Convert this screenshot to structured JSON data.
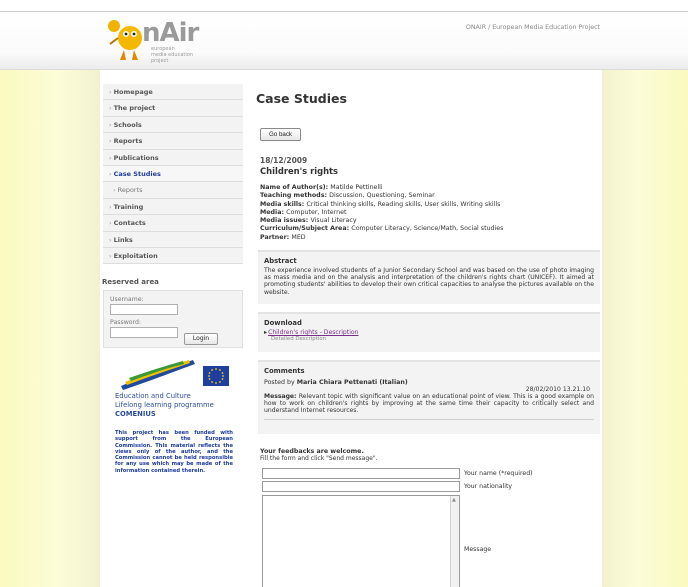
{
  "header": {
    "logo_word": "nAir",
    "logo_sub": [
      "european",
      "media education",
      "project"
    ],
    "site_title": "ONAIR / European Media Education Project"
  },
  "nav": {
    "items": [
      {
        "label": "Homepage"
      },
      {
        "label": "The project"
      },
      {
        "label": "Schools"
      },
      {
        "label": "Reports"
      },
      {
        "label": "Publications"
      },
      {
        "label": "Case Studies",
        "active": true
      },
      {
        "label": "Reports",
        "sub": true
      },
      {
        "label": "Training"
      },
      {
        "label": "Contacts"
      },
      {
        "label": "Links"
      },
      {
        "label": "Exploitation"
      }
    ]
  },
  "reserved": {
    "title": "Reserved area",
    "username_label": "Username:",
    "password_label": "Password:",
    "login_label": "Login"
  },
  "sidebar_footer": {
    "edu_line1": "Education and Culture",
    "edu_line2": "Lifelong learning programme",
    "edu_line3": "COMENIUS",
    "funding": "This project has been funded with support from the European Commission. This material reflects the views only of the author, and the Commission cannot be held responsible for any use which may be made of the information contained therein."
  },
  "main": {
    "page_title": "Case Studies",
    "go_back": "Go back",
    "date": "18/12/2009",
    "case_title": "Children's rights",
    "meta": [
      {
        "k": "Name of Author(s): ",
        "v": "Matilde Pettinelli"
      },
      {
        "k": "Teaching methods: ",
        "v": "Discussion, Questioning, Seminar"
      },
      {
        "k": "Media skills: ",
        "v": "Critical thinking skills, Reading skills, User skills, Writing skills"
      },
      {
        "k": "Media: ",
        "v": "Computer, Internet"
      },
      {
        "k": "Media issues: ",
        "v": "Visual Literacy"
      },
      {
        "k": "Curriculum/Subject Area: ",
        "v": "Computer Literacy, Science/Math, Social studies"
      },
      {
        "k": "Partner: ",
        "v": "MED"
      }
    ],
    "abstract": {
      "title": "Abstract",
      "body": "The experience involved students of a Junior Secondary School and was based on the use of photo imaging as mass media and on the analysis and interpretation of the children's rights chart (UNICEF). It aimed at promoting students' abilities to develop their own critical capacities to analyse the pictures available on the website."
    },
    "download": {
      "title": "Download",
      "link": "Children's rights - Description",
      "desc": "Detailed Description"
    },
    "comments": {
      "title": "Comments",
      "posted_by": "Posted by ",
      "author": "Maria Chiara Pettenati (Italian)",
      "date": "28/02/2010 13.21.10",
      "message_label": "Message: ",
      "message": "Relevant topic with significant value on an educational point of view. This is a good example on how to work on children's rights by improving at the same time their capacity to critically select and understand Internet resources."
    },
    "feedback": {
      "title": "Your feedbacks are welcome.",
      "subtitle": "Fill the form and click \"Send message\".",
      "name_label": "Your name (*required)",
      "nationality_label": "Your nationality",
      "message_label": "Message"
    }
  }
}
